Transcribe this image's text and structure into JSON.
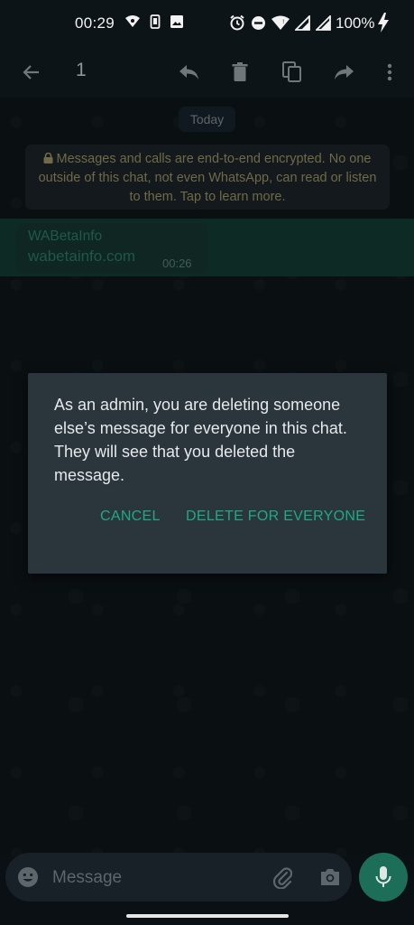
{
  "status_bar": {
    "time": "00:29",
    "battery": "100%"
  },
  "toolbar": {
    "selected_count": "1"
  },
  "chat": {
    "date_chip": "Today",
    "encryption_notice": "Messages and calls are end-to-end encrypted. No one outside of this chat, not even WhatsApp, can read or listen to them. Tap to learn more.",
    "message": {
      "sender": "WABetaInfo",
      "text": "wabetainfo.com",
      "time": "00:26"
    }
  },
  "dialog": {
    "text": "As an admin, you are deleting someone else’s message for everyone in this chat. They will see that you deleted the message.",
    "cancel_label": "CANCEL",
    "confirm_label": "DELETE FOR EVERYONE"
  },
  "input": {
    "placeholder": "Message"
  },
  "colors": {
    "accent": "#1fa985",
    "dialog_bg": "#2a363c",
    "mic_bg": "#1c6e58"
  }
}
